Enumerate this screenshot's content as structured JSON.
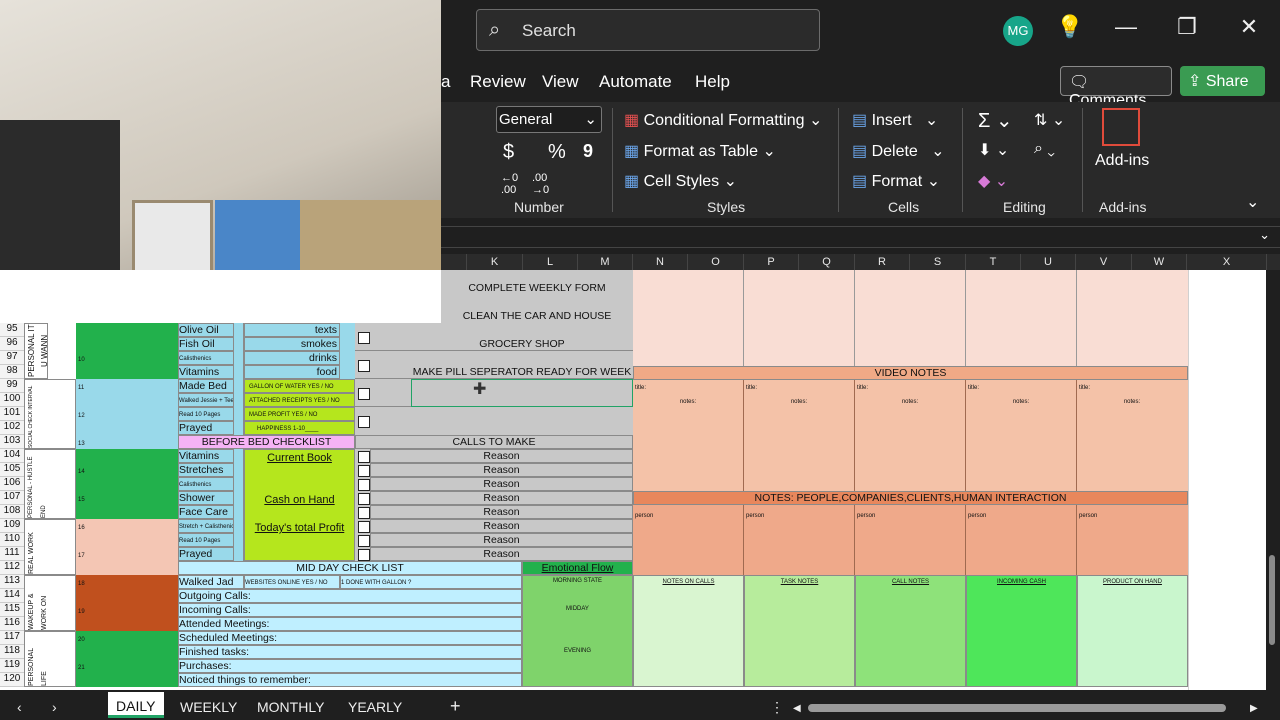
{
  "search": {
    "placeholder": "Search"
  },
  "account": {
    "initials": "MG"
  },
  "window": {
    "minimize": "—",
    "restore": "❐",
    "close": "✕",
    "lightbulb": "💡"
  },
  "menu": {
    "partial": "a",
    "items": [
      "Review",
      "View",
      "Automate",
      "Help"
    ],
    "comments": "Comments",
    "share": "Share"
  },
  "ribbon": {
    "number_format": "General",
    "currency": "$",
    "percent": "%",
    "comma": "9",
    "inc_decimal": "←0 .00",
    "dec_decimal": ".00 →0",
    "number_group": "Number",
    "cond_format": "Conditional Formatting",
    "format_table": "Format as Table",
    "cell_styles": "Cell Styles",
    "styles_group": "Styles",
    "insert": "Insert",
    "delete": "Delete",
    "format": "Format",
    "cells_group": "Cells",
    "editing_group": "Editing",
    "addins": "Add-ins",
    "addins_group": "Add-ins"
  },
  "columns": [
    "K",
    "L",
    "M",
    "N",
    "O",
    "P",
    "Q",
    "R",
    "S",
    "T",
    "U",
    "V",
    "W",
    "X"
  ],
  "rows": [
    "95",
    "96",
    "97",
    "98",
    "99",
    "100",
    "101",
    "102",
    "103",
    "104",
    "105",
    "106",
    "107",
    "108",
    "109",
    "110",
    "111",
    "112",
    "113",
    "114",
    "115",
    "116",
    "117",
    "118",
    "119",
    "120"
  ],
  "sheet": {
    "weekly_tasks": [
      "COMPLETE WEEKLY FORM",
      "CLEAN THE CAR AND HOUSE",
      "GROCERY SHOP",
      "MAKE PILL SEPERATOR READY FOR WEEK"
    ],
    "side_personal": "PERSONAL IT U WANN",
    "side_social": "SOCIAL CHECK INTERVAL",
    "side_personal2": "PERSONAL - HUSTLE END",
    "side_real": "REAL WORK",
    "side_wakeup": "WAKEUP & WORK ON",
    "side_personal3": "PERSONAL LIFE",
    "habits": [
      "Olive Oil",
      "Fish Oil",
      "Calisthenics",
      "Vitamins",
      "Made Bed",
      "Walked Jessie + Teeth",
      "Read 10 Pages",
      "Prayed"
    ],
    "avoid": [
      "texts",
      "smokes",
      "drinks",
      "food"
    ],
    "goals": [
      "GALLON OF WATER    YES  /  NO",
      "ATTACHED RECEIPTS    YES  /  NO",
      "MADE PROFIT    YES  /  NO",
      "HAPPINESS 1-10____"
    ],
    "nums": [
      "10",
      "11",
      "12",
      "13",
      "14",
      "15",
      "16",
      "17",
      "18",
      "19",
      "20",
      "21"
    ],
    "before_bed": "BEFORE BED CHECKLIST",
    "bed_items": [
      "Vitamins",
      "Stretches",
      "Calisthenics",
      "Shower",
      "Face Care",
      "Stretch + Calisthenics",
      "Read 10 Pages",
      "Prayed"
    ],
    "current_book": "Current Book",
    "cash_on_hand": "Cash on Hand",
    "total_profit": "Today's total Profit",
    "calls_to_make": "CALLS TO MAKE",
    "reason": "Reason",
    "mid_day": "MID DAY CHECK LIST",
    "emotional_flow": "Emotional Flow",
    "emo_times": [
      "MORNING STATE",
      "MIDDAY",
      "EVENING"
    ],
    "walked": "Walked Jad",
    "websites": "WEBSITES ONLINE  YES  /  NO",
    "gallon_done": "1 DONE WITH GALLON ?",
    "midday_items": [
      "Outgoing Calls:",
      "Incoming Calls:",
      "Attended Meetings:",
      "Scheduled Meetings:",
      "Finished tasks:",
      "Purchases:",
      "Noticed things to remember:"
    ],
    "video_notes": "VIDEO NOTES",
    "title_lbl": "title:",
    "notes_lbl": "notes:",
    "notes_people": "NOTES: PEOPLE,COMPANIES,CLIENTS,HUMAN INTERACTION",
    "person_lbl": "person",
    "bottom_headers": [
      "NOTES ON CALLS",
      "TASK NOTES",
      "CALL NOTES",
      "INCOMING CASH",
      "PRODUCT ON HAND"
    ]
  },
  "tabs": [
    "DAILY",
    "WEEKLY",
    "MONTHLY",
    "YEARLY"
  ],
  "add_tab": "+",
  "colors": {
    "green": "#22b14c",
    "lightblue": "#99d9ea",
    "pink": "#f4cccc",
    "salmon": "#f0a986",
    "gray": "#c8c8c8"
  }
}
